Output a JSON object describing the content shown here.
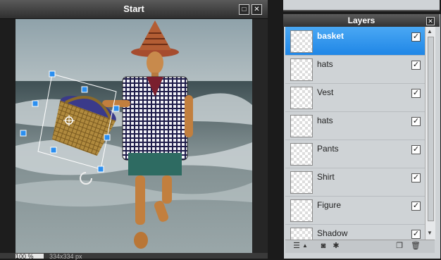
{
  "start_window": {
    "title": "Start",
    "zoom": "100",
    "zoom_unit": "%",
    "dimensions": "334x334 px"
  },
  "layers_panel": {
    "title": "Layers",
    "layers": [
      {
        "name": "basket",
        "visible": true,
        "selected": true
      },
      {
        "name": "hats",
        "visible": true,
        "selected": false
      },
      {
        "name": "Vest",
        "visible": true,
        "selected": false
      },
      {
        "name": "hats",
        "visible": true,
        "selected": false
      },
      {
        "name": "Pants",
        "visible": true,
        "selected": false
      },
      {
        "name": "Shirt",
        "visible": true,
        "selected": false
      },
      {
        "name": "Figure",
        "visible": true,
        "selected": false
      },
      {
        "name": "Shadow",
        "visible": true,
        "selected": false
      }
    ]
  },
  "icons": {
    "maximize": "maximize-icon",
    "close": "close-icon",
    "layer_properties": "layer-settings-icon",
    "mask": "mask-icon",
    "effects": "effects-icon",
    "new_layer": "new-layer-icon",
    "delete_layer": "trash-icon"
  },
  "colors": {
    "selected_row": "#2b8ff0",
    "panel_bg": "#cfd3d6",
    "window_bg": "#1d1d1d"
  }
}
